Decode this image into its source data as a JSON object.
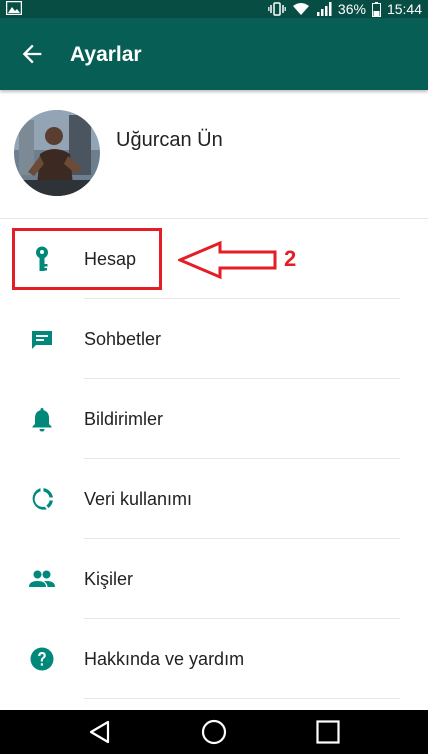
{
  "status_bar": {
    "battery": "36%",
    "time": "15:44",
    "icons": [
      "gallery-icon",
      "vibrate-icon",
      "wifi-icon",
      "signal-icon",
      "battery-icon"
    ]
  },
  "app_bar": {
    "title": "Ayarlar",
    "back_icon": "arrow-left-icon",
    "color": "#075e54"
  },
  "profile": {
    "name": "Uğurcan Ün"
  },
  "menu": [
    {
      "label": "Hesap",
      "icon": "key-icon"
    },
    {
      "label": "Sohbetler",
      "icon": "chat-icon"
    },
    {
      "label": "Bildirimler",
      "icon": "bell-icon"
    },
    {
      "label": "Veri kullanımı",
      "icon": "data-usage-icon"
    },
    {
      "label": "Kişiler",
      "icon": "contacts-icon"
    },
    {
      "label": "Hakkında ve yardım",
      "icon": "help-icon"
    }
  ],
  "annotation": {
    "number": "2",
    "color": "#e41e26"
  },
  "icon_color": "#00897b",
  "nav_bar": {
    "buttons": [
      "back-icon",
      "home-icon",
      "recents-icon"
    ]
  }
}
